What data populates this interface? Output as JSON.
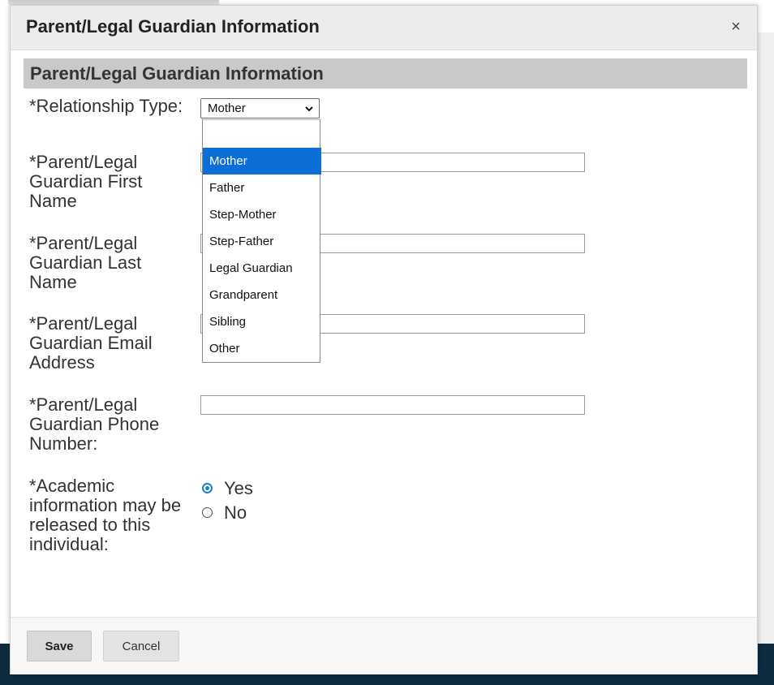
{
  "modal": {
    "title": "Parent/Legal Guardian Information",
    "close_label": "×"
  },
  "section": {
    "title": "Parent/Legal Guardian Information"
  },
  "fields": {
    "relationship_label": "*Relationship Type:",
    "first_name_label": "*Parent/Legal Guardian First Name",
    "last_name_label": "*Parent/Legal Guardian Last Name",
    "email_label": "*Parent/Legal Guardian Email Address",
    "phone_label": "*Parent/Legal Guardian Phone Number:",
    "release_label": "*Academic information may be released to this individual:"
  },
  "relationship_select": {
    "value": "Mother",
    "chevron": "⌄",
    "options": [
      "Mother",
      "Father",
      "Step-Mother",
      "Step-Father",
      "Legal Guardian",
      "Grandparent",
      "Sibling",
      "Other"
    ],
    "highlighted": "Mother"
  },
  "inputs": {
    "first_name": "",
    "last_name": "",
    "email": "",
    "phone": ""
  },
  "release_options": [
    {
      "label": "Yes",
      "checked": true
    },
    {
      "label": "No",
      "checked": false
    }
  ],
  "footer": {
    "save_label": "Save",
    "cancel_label": "Cancel"
  },
  "colors": {
    "highlight": "#0b6fd6",
    "radio_accent": "#1a7fd1",
    "page_footer": "#0d2a3f"
  }
}
